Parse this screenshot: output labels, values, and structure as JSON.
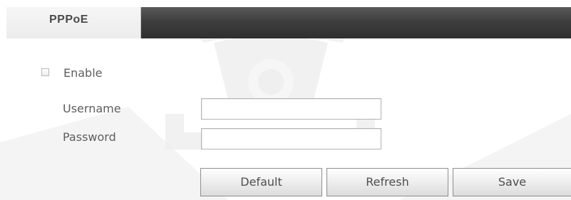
{
  "tabs": {
    "pppoe_label": "PPPoE"
  },
  "form": {
    "enable_label": "Enable",
    "enable_checked": false,
    "username_label": "Username",
    "username_value": "",
    "password_label": "Password",
    "password_value": ""
  },
  "buttons": {
    "default_label": "Default",
    "refresh_label": "Refresh",
    "save_label": "Save"
  },
  "colors": {
    "tab_bar": "#3e3e3e",
    "active_tab": "#ececec",
    "text": "#5e5e5e"
  },
  "icons": {
    "watermark": "security-camera-icon"
  }
}
